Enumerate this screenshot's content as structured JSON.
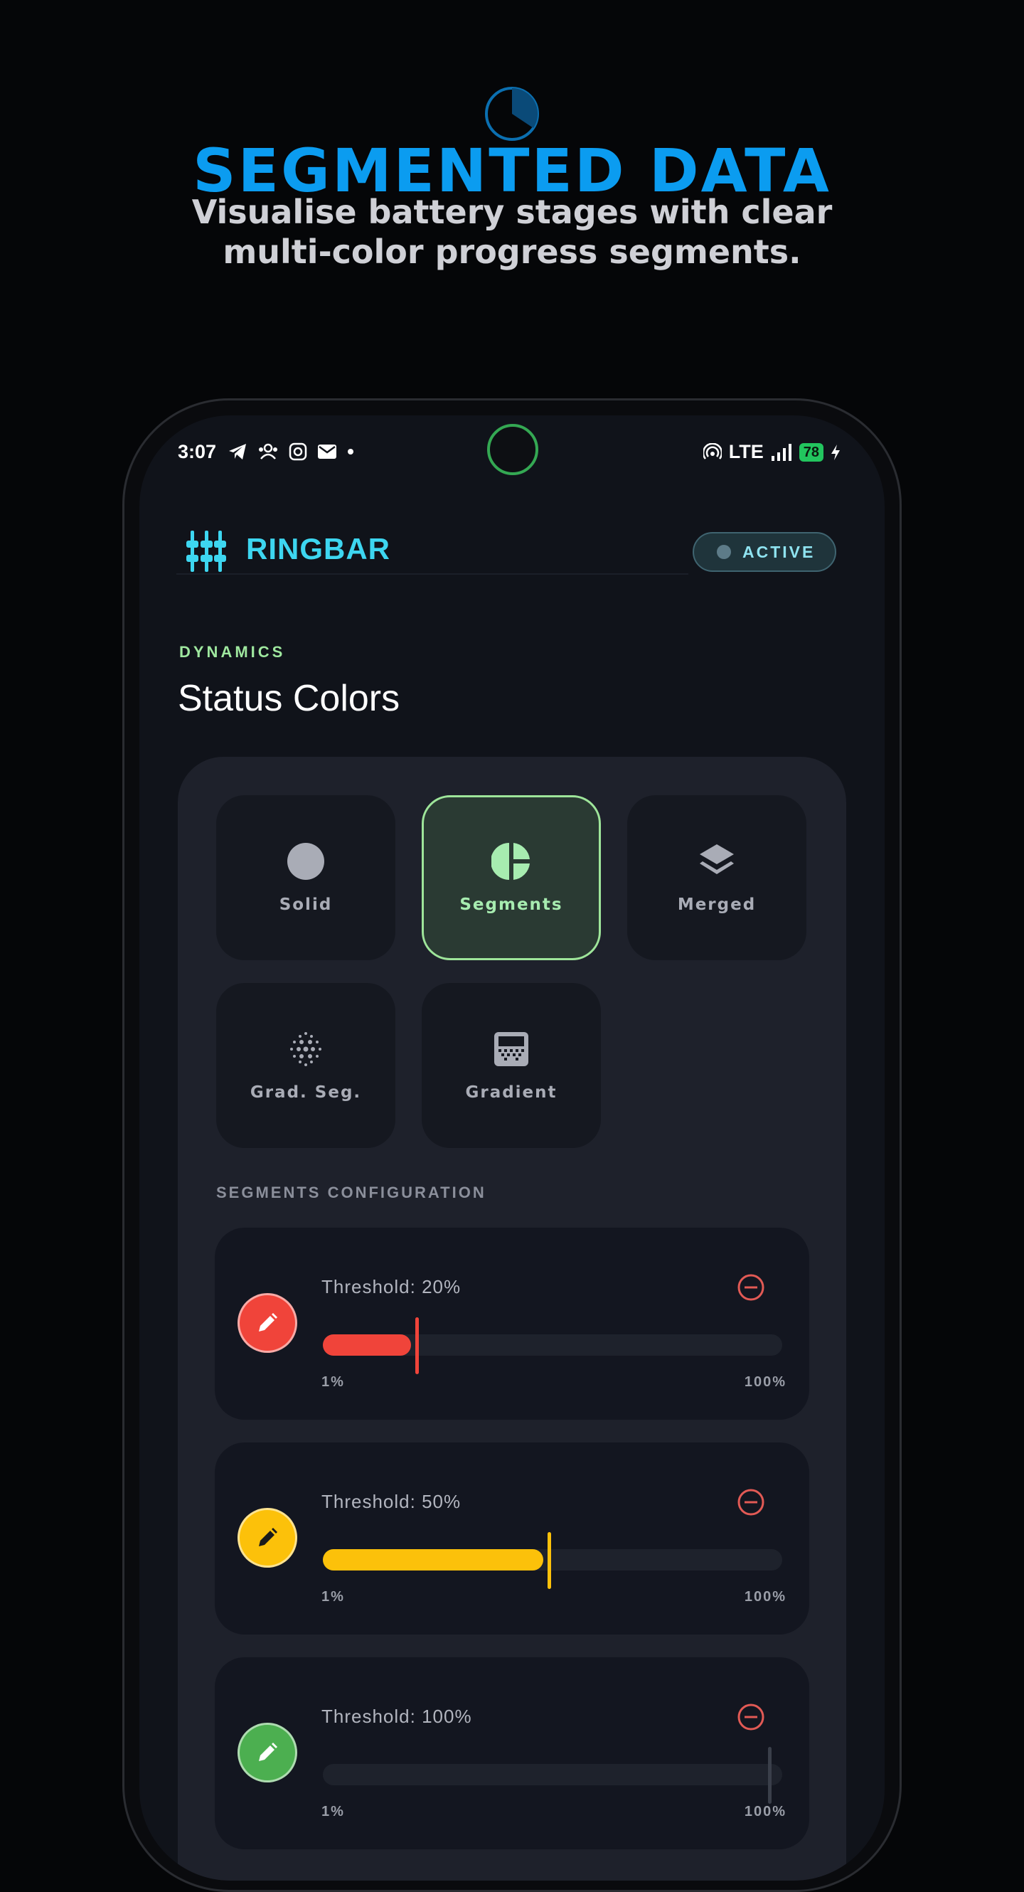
{
  "promo": {
    "title": "SEGMENTED DATA",
    "subtitle": "Visualise battery stages with clear multi-color progress segments.",
    "title_color": "#0b9cf0"
  },
  "status_bar": {
    "time": "3:07",
    "notification_icons": [
      "telegram-icon",
      "group-icon",
      "instagram-icon",
      "mail-icon",
      "dot-icon"
    ],
    "network": "LTE",
    "battery": "78",
    "battery_color": "#22c55e",
    "ring_color": "#34a853"
  },
  "app": {
    "title": "RINGBAR",
    "status_pill": "ACTIVE",
    "accent": "#3dd6f0"
  },
  "section": {
    "eyebrow": "DYNAMICS",
    "title": "Status Colors"
  },
  "modes": [
    {
      "label": "Solid",
      "icon": "circle-icon",
      "selected": false
    },
    {
      "label": "Segments",
      "icon": "pie-segments-icon",
      "selected": true
    },
    {
      "label": "Merged",
      "icon": "layers-icon",
      "selected": false
    },
    {
      "label": "Grad. Seg.",
      "icon": "dotted-gradient-icon",
      "selected": false
    },
    {
      "label": "Gradient",
      "icon": "gradient-box-icon",
      "selected": false
    }
  ],
  "config": {
    "heading": "SEGMENTS CONFIGURATION",
    "segments": [
      {
        "label": "Threshold: 20%",
        "value": 20,
        "color": "#f0443a",
        "min_label": "1%",
        "max_label": "100%"
      },
      {
        "label": "Threshold: 50%",
        "value": 50,
        "color": "#fcc10a",
        "min_label": "1%",
        "max_label": "100%"
      },
      {
        "label": "Threshold: 100%",
        "value": 100,
        "color": "#4caf50",
        "min_label": "1%",
        "max_label": "100%"
      }
    ]
  }
}
